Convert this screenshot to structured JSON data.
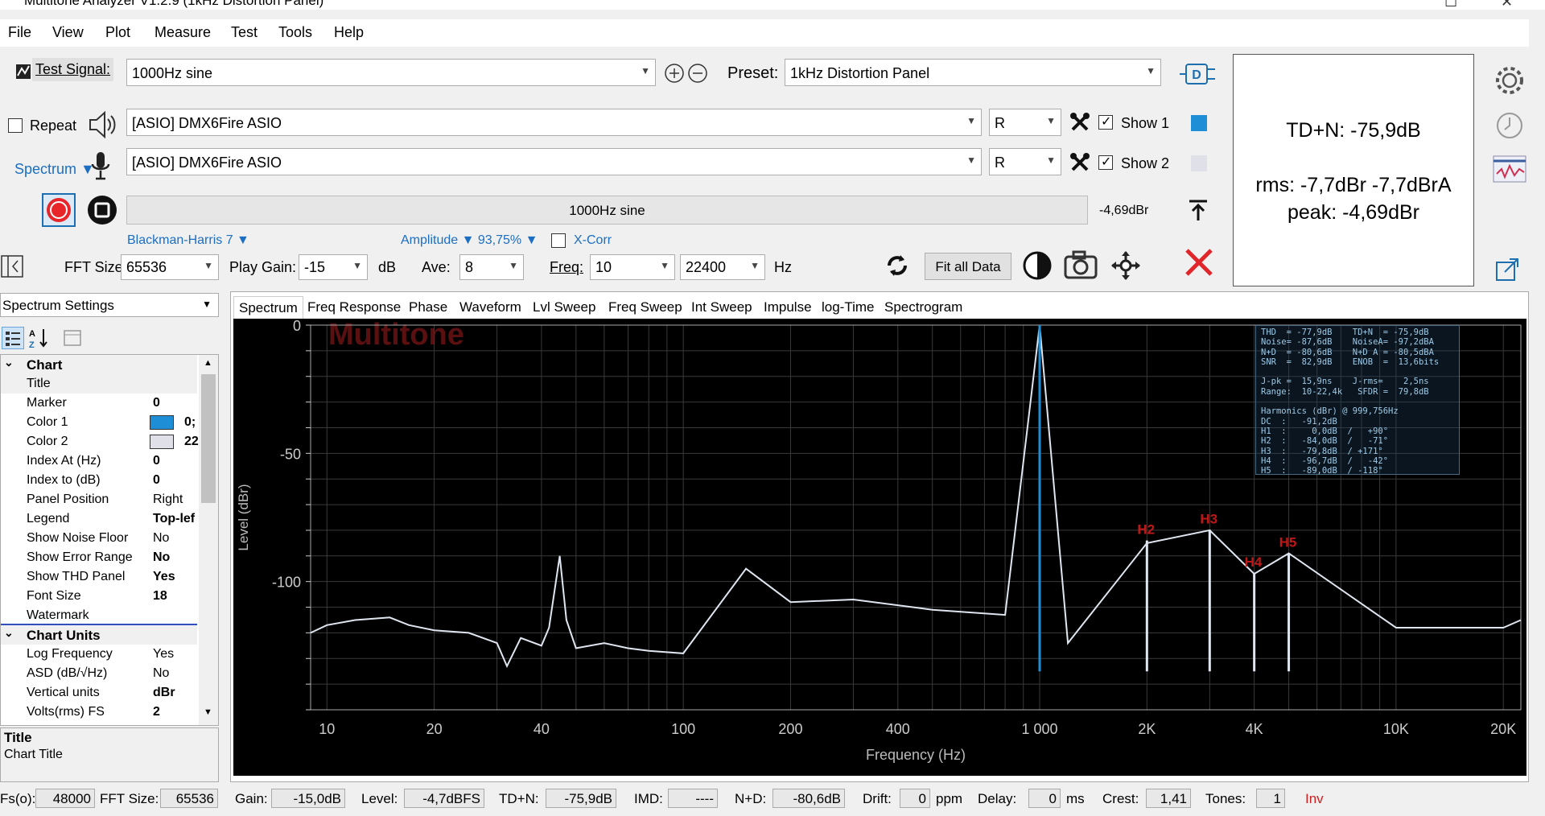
{
  "window": {
    "title": "Multitone Analyzer V1.2.9 (1kHz Distortion Panel)"
  },
  "menu": [
    "File",
    "View",
    "Plot",
    "Measure",
    "Test",
    "Tools",
    "Help"
  ],
  "toolbar": {
    "test_signal_label": "Test Signal:",
    "test_signal_value": "1000Hz sine",
    "preset_label": "Preset:",
    "preset_value": "1kHz Distortion Panel",
    "repeat_label": "Repeat",
    "out_device": "[ASIO] DMX6Fire ASIO",
    "out_channel": "R",
    "show1_label": "Show 1",
    "in_device": "[ASIO] DMX6Fire ASIO",
    "in_channel": "R",
    "show2_label": "Show 2",
    "spectrum_mode": "Spectrum ▼",
    "progress_text": "1000Hz sine",
    "level_readout": "-4,69dBr",
    "window_fn": "Blackman-Harris 7 ▼",
    "amplitude": "Amplitude ▼ 93,75% ▼",
    "xcorr_label": "X-Corr",
    "fft_size_label": "FFT Size:",
    "fft_size_value": "65536",
    "play_gain_label": "Play Gain:",
    "play_gain_value": "-15",
    "db_unit": "dB",
    "ave_label": "Ave:",
    "ave_value": "8",
    "freq_label": "Freq:",
    "freq_from": "10",
    "freq_to": "22400",
    "hz_unit": "Hz",
    "fit_all_label": "Fit all Data",
    "colors": {
      "show1": "#1e8fd6",
      "show2": "#e0e0e8"
    }
  },
  "thd_box": {
    "line1": "TD+N: -75,9dB",
    "line2": "rms: -7,7dBr  -7,7dBrA",
    "line3": "peak: -4,69dBr"
  },
  "settings": {
    "header": "Spectrum Settings",
    "categories": [
      {
        "name": "Chart",
        "rows": [
          {
            "k": "Title",
            "v": ""
          },
          {
            "k": "Marker",
            "v": "0"
          },
          {
            "k": "Color 1",
            "v": "0;"
          },
          {
            "k": "Color 2",
            "v": "22"
          },
          {
            "k": "Index At (Hz)",
            "v": "0"
          },
          {
            "k": "Index to (dB)",
            "v": "0"
          },
          {
            "k": "Panel Position",
            "v": "Right"
          },
          {
            "k": "Legend",
            "v": "Top-lef"
          },
          {
            "k": "Show Noise Floor",
            "v": "No"
          },
          {
            "k": "Show Error Range",
            "v": "No"
          },
          {
            "k": "Show THD Panel",
            "v": "Yes"
          },
          {
            "k": "Font Size",
            "v": "18"
          },
          {
            "k": "Watermark",
            "v": ""
          }
        ]
      },
      {
        "name": "Chart Units",
        "rows": [
          {
            "k": "Log Frequency",
            "v": "Yes"
          },
          {
            "k": "ASD (dB/√Hz)",
            "v": "No"
          },
          {
            "k": "Vertical units",
            "v": "dBr"
          },
          {
            "k": "Volts(rms) FS",
            "v": "2"
          }
        ]
      }
    ],
    "desc_title": "Title",
    "desc_text": "Chart Title"
  },
  "tabs": [
    "Spectrum",
    "Freq Response",
    "Phase",
    "Waveform",
    "Lvl Sweep",
    "Freq Sweep",
    "Int Sweep",
    "Impulse",
    "log-Time",
    "Spectrogram"
  ],
  "chart_data": {
    "type": "line",
    "watermark": "Multitone",
    "xlabel": "Frequency (Hz)",
    "ylabel": "Level (dBr)",
    "x_scale": "log",
    "xlim": [
      9,
      22400
    ],
    "ylim": [
      -150,
      0
    ],
    "x_ticks": [
      "10",
      "20",
      "40",
      "100",
      "200",
      "400",
      "1 000",
      "2K",
      "4K",
      "10K",
      "20K"
    ],
    "x_tick_values": [
      10,
      20,
      40,
      100,
      200,
      400,
      1000,
      2000,
      4000,
      10000,
      20000
    ],
    "y_ticks": [
      "0",
      "-50",
      "-100"
    ],
    "y_tick_values": [
      0,
      -50,
      -100
    ],
    "series": [
      {
        "values": [
          [
            9,
            -120
          ],
          [
            10,
            -117
          ],
          [
            12,
            -115
          ],
          [
            15,
            -114
          ],
          [
            17,
            -117
          ],
          [
            20,
            -119
          ],
          [
            25,
            -120
          ],
          [
            30,
            -124
          ],
          [
            32,
            -133
          ],
          [
            35,
            -122
          ],
          [
            40,
            -125
          ],
          [
            42,
            -118
          ],
          [
            45,
            -90
          ],
          [
            47,
            -115
          ],
          [
            50,
            -126
          ],
          [
            60,
            -124
          ],
          [
            70,
            -126
          ],
          [
            80,
            -127
          ],
          [
            100,
            -128
          ],
          [
            150,
            -95
          ],
          [
            200,
            -108
          ],
          [
            300,
            -107
          ],
          [
            500,
            -111
          ],
          [
            800,
            -113
          ],
          [
            1000,
            0
          ],
          [
            1200,
            -124
          ],
          [
            2000,
            -85
          ],
          [
            3000,
            -80
          ],
          [
            4000,
            -97
          ],
          [
            5000,
            -89
          ],
          [
            10000,
            -118
          ],
          [
            20000,
            -118
          ],
          [
            22400,
            -115
          ]
        ]
      }
    ],
    "harmonic_labels": [
      {
        "name": "H2",
        "x": 2000,
        "y": -84
      },
      {
        "name": "H3",
        "x": 3000,
        "y": -79.8
      },
      {
        "name": "H4",
        "x": 4000,
        "y": -96.7
      },
      {
        "name": "H5",
        "x": 5000,
        "y": -89
      }
    ]
  },
  "stat_panel": "THD  = -77,9dB    TD+N  = -75,9dB\nNoise= -87,6dB    NoiseA= -97,2dBA\nN+D  = -80,6dB    N+D A = -80,5dBA\nSNR  =  82,9dB    ENOB  =  13,6bits\n\nJ-pk =  15,9ns    J-rms=    2,5ns\nRange:  10-22,4k   SFDR =  79,8dB\n\nHarmonics (dBr) @ 999,756Hz\nDC  :   -91,2dB\nH1  :     0,0dB  /   +90°\nH2  :   -84,0dB  /   -71°\nH3  :   -79,8dB  / +171°\nH4  :   -96,7dB  /   -42°\nH5  :   -89,0dB  / -118°",
  "status": {
    "fs_label": "Fs(o):",
    "fs_value": "48000",
    "fft_label": "FFT Size:",
    "fft_value": "65536",
    "gain_label": "Gain:",
    "gain_value": "-15,0dB",
    "level_label": "Level:",
    "level_value": "-4,7dBFS",
    "tdn_label": "TD+N:",
    "tdn_value": "-75,9dB",
    "imd_label": "IMD:",
    "imd_value": "----",
    "nd_label": "N+D:",
    "nd_value": "-80,6dB",
    "drift_label": "Drift:",
    "drift_value": "0",
    "drift_unit": "ppm",
    "delay_label": "Delay:",
    "delay_value": "0",
    "delay_unit": "ms",
    "crest_label": "Crest:",
    "crest_value": "1,41",
    "tones_label": "Tones:",
    "tones_value": "1",
    "inv_label": "Inv"
  }
}
